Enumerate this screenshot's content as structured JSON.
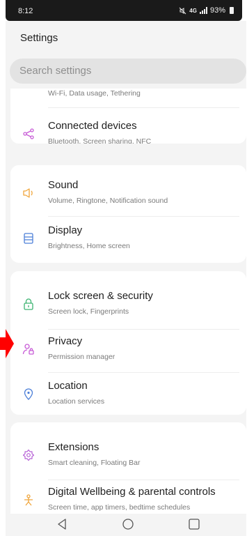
{
  "status_bar": {
    "time": "8:12",
    "network": "4G",
    "battery": "93%"
  },
  "header": {
    "title": "Settings"
  },
  "search": {
    "placeholder": "Search settings"
  },
  "sections": [
    {
      "partial_subtitle": "Wi-Fi, Data usage, Tethering",
      "items": [
        {
          "title": "Connected devices",
          "subtitle": "Bluetooth, Screen sharing, NFC",
          "icon": "share-icon",
          "color": "#c75bd6"
        }
      ]
    },
    {
      "items": [
        {
          "title": "Sound",
          "subtitle": "Volume, Ringtone, Notification sound",
          "icon": "speaker-icon",
          "color": "#f0a53a"
        },
        {
          "title": "Display",
          "subtitle": "Brightness, Home screen",
          "icon": "display-icon",
          "color": "#4c7fd8"
        }
      ]
    },
    {
      "items": [
        {
          "title": "Lock screen & security",
          "subtitle": "Screen lock, Fingerprints",
          "icon": "lock-icon",
          "color": "#3cb371"
        },
        {
          "title": "Privacy",
          "subtitle": "Permission manager",
          "icon": "privacy-person-icon",
          "color": "#c75bd6"
        },
        {
          "title": "Location",
          "subtitle": "Location services",
          "icon": "location-pin-icon",
          "color": "#4c7fd8"
        }
      ]
    },
    {
      "items": [
        {
          "title": "Extensions",
          "subtitle": "Smart cleaning, Floating Bar",
          "icon": "extensions-icon",
          "color": "#b660d6"
        },
        {
          "title": "Digital Wellbeing & parental controls",
          "subtitle": "Screen time, app timers, bedtime schedules",
          "icon": "wellbeing-icon",
          "color": "#f0a53a"
        }
      ]
    }
  ],
  "nav_bar": {
    "buttons": [
      "back-icon",
      "home-icon",
      "recents-icon"
    ]
  },
  "annotation": {
    "pointer_color": "#ff0000"
  }
}
